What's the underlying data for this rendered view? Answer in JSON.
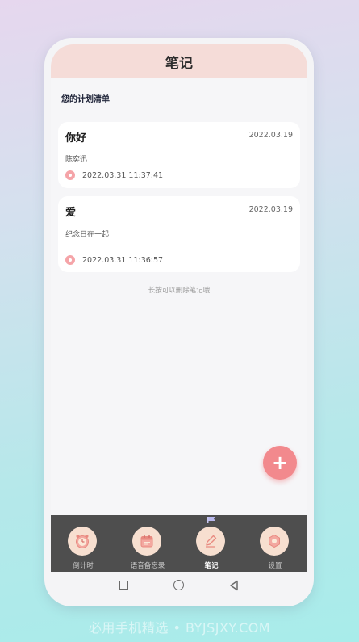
{
  "header": {
    "title": "笔记"
  },
  "section": {
    "title": "您的计划清单"
  },
  "notes": [
    {
      "title": "你好",
      "date": "2022.03.19",
      "content": "陈奕迅",
      "time": "2022.03.31 11:37:41"
    },
    {
      "title": "爱",
      "date": "2022.03.19",
      "content": "纪念日在一起",
      "time": "2022.03.31 11:36:57"
    }
  ],
  "hint": "长按可以删除笔记哦",
  "fab": {
    "icon": "plus-icon",
    "label": "+"
  },
  "nav": {
    "items": [
      {
        "label": "倒计时",
        "icon": "alarm-clock-icon",
        "active": false
      },
      {
        "label": "语音备忘录",
        "icon": "calendar-icon",
        "active": false
      },
      {
        "label": "笔记",
        "icon": "pen-icon",
        "active": true
      },
      {
        "label": "设置",
        "icon": "gear-icon",
        "active": false
      }
    ]
  },
  "system_nav": {
    "recents": "square-icon",
    "home": "circle-icon",
    "back": "back-triangle-icon"
  },
  "watermark": "必用手机精选 • BYJSJXY.COM",
  "colors": {
    "header_bg": "#f5dcd8",
    "accent": "#f2898d",
    "nav_bg": "#4e4e4e",
    "nav_icon_bg": "#f7dfd0"
  }
}
